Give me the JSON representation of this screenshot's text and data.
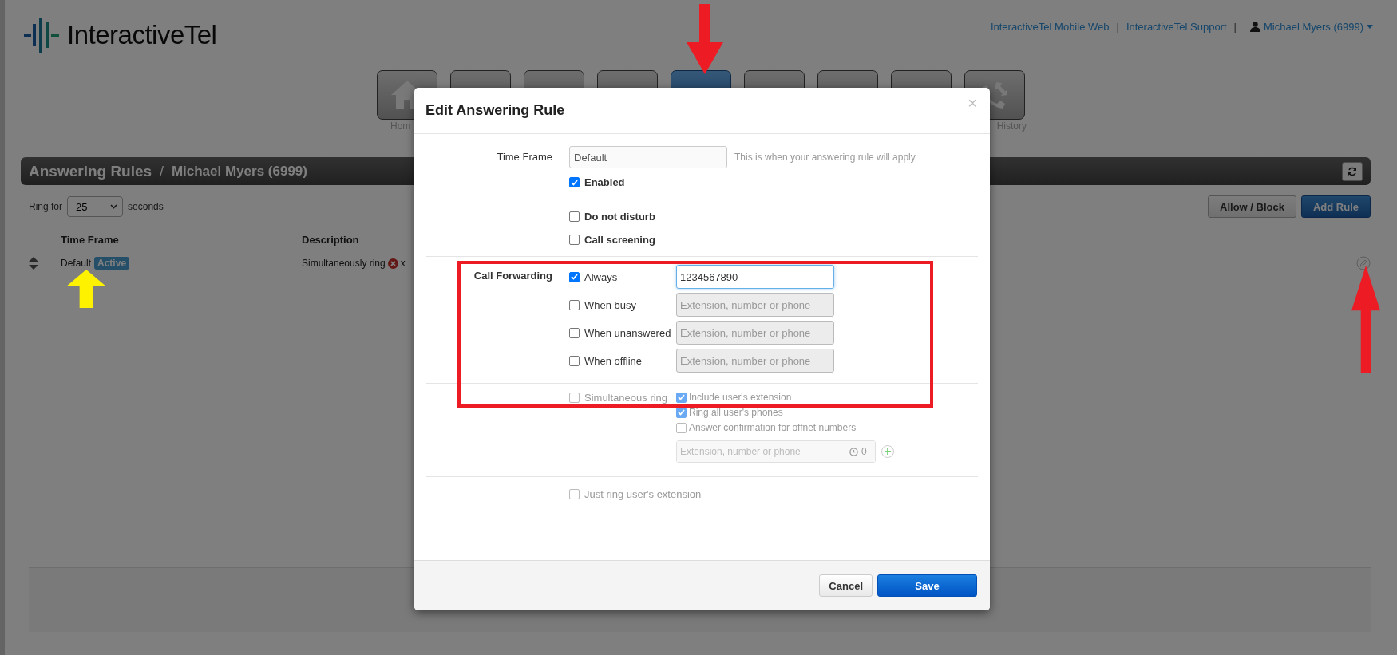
{
  "header": {
    "logo": "InteractiveTel",
    "links": [
      "InteractiveTel Mobile Web",
      "InteractiveTel Support"
    ],
    "separator": "|",
    "user": "Michael Myers (6999)"
  },
  "nav_tiles": [
    {
      "kind": "home",
      "label": "Hom",
      "selected": false
    },
    {
      "kind": "plain",
      "selected": false
    },
    {
      "kind": "plain",
      "selected": false
    },
    {
      "kind": "plain",
      "selected": false
    },
    {
      "kind": "plain",
      "selected": true
    },
    {
      "kind": "plain",
      "selected": false
    },
    {
      "kind": "plain",
      "selected": false
    },
    {
      "kind": "plain",
      "selected": false
    },
    {
      "kind": "history",
      "label": "History",
      "selected": false
    }
  ],
  "section": {
    "title": "Answering Rules",
    "separator": "/",
    "subtitle": "Michael Myers (6999)"
  },
  "ring": {
    "prefix": "Ring for",
    "value": "25",
    "suffix": "seconds"
  },
  "actions": [
    {
      "label": "Allow / Block",
      "kind": "default"
    },
    {
      "label": "Add Rule",
      "kind": "primary"
    }
  ],
  "table": {
    "columns": [
      "Time Frame",
      "Description"
    ],
    "rows": [
      {
        "time_frame": "Default",
        "status": "Active",
        "description": "Simultaneously ring",
        "description_tail": "x"
      }
    ]
  },
  "modal": {
    "title": "Edit Answering Rule",
    "close": "×",
    "time_frame": {
      "label": "Time Frame",
      "value": "Default",
      "hint": "This is when your answering rule will apply"
    },
    "enabled": {
      "label": "Enabled",
      "checked": true
    },
    "options": [
      {
        "label": "Do not disturb",
        "checked": false
      },
      {
        "label": "Call screening",
        "checked": false
      }
    ],
    "forwarding": {
      "label": "Call Forwarding",
      "rows": [
        {
          "label": "Always",
          "checked": true,
          "value": "1234567890"
        },
        {
          "label": "When busy",
          "checked": false,
          "placeholder": "Extension, number or phone"
        },
        {
          "label": "When unanswered",
          "checked": false,
          "placeholder": "Extension, number or phone"
        },
        {
          "label": "When offline",
          "checked": false,
          "placeholder": "Extension, number or phone"
        }
      ]
    },
    "simultaneous": {
      "label": "Simultaneous ring",
      "checked": false,
      "disabled": true,
      "options": [
        {
          "label": "Include user's extension",
          "checked": true
        },
        {
          "label": "Ring all user's phones",
          "checked": true
        },
        {
          "label": "Answer confirmation for offnet numbers",
          "checked": false
        }
      ],
      "placeholder": "Extension, number or phone",
      "timer": "0"
    },
    "just_ring": {
      "label": "Just ring user's extension",
      "checked": false,
      "disabled": true
    },
    "buttons": [
      {
        "label": "Cancel",
        "kind": "default"
      },
      {
        "label": "Save",
        "kind": "primary"
      }
    ]
  },
  "annotations": [
    {
      "kind": "arrow-down",
      "color": "#ed1c24"
    },
    {
      "kind": "arrow-up",
      "color": "#ed1c24"
    },
    {
      "kind": "arrow-up",
      "color": "#fff200"
    },
    {
      "kind": "box",
      "color": "#ed1c24"
    }
  ]
}
